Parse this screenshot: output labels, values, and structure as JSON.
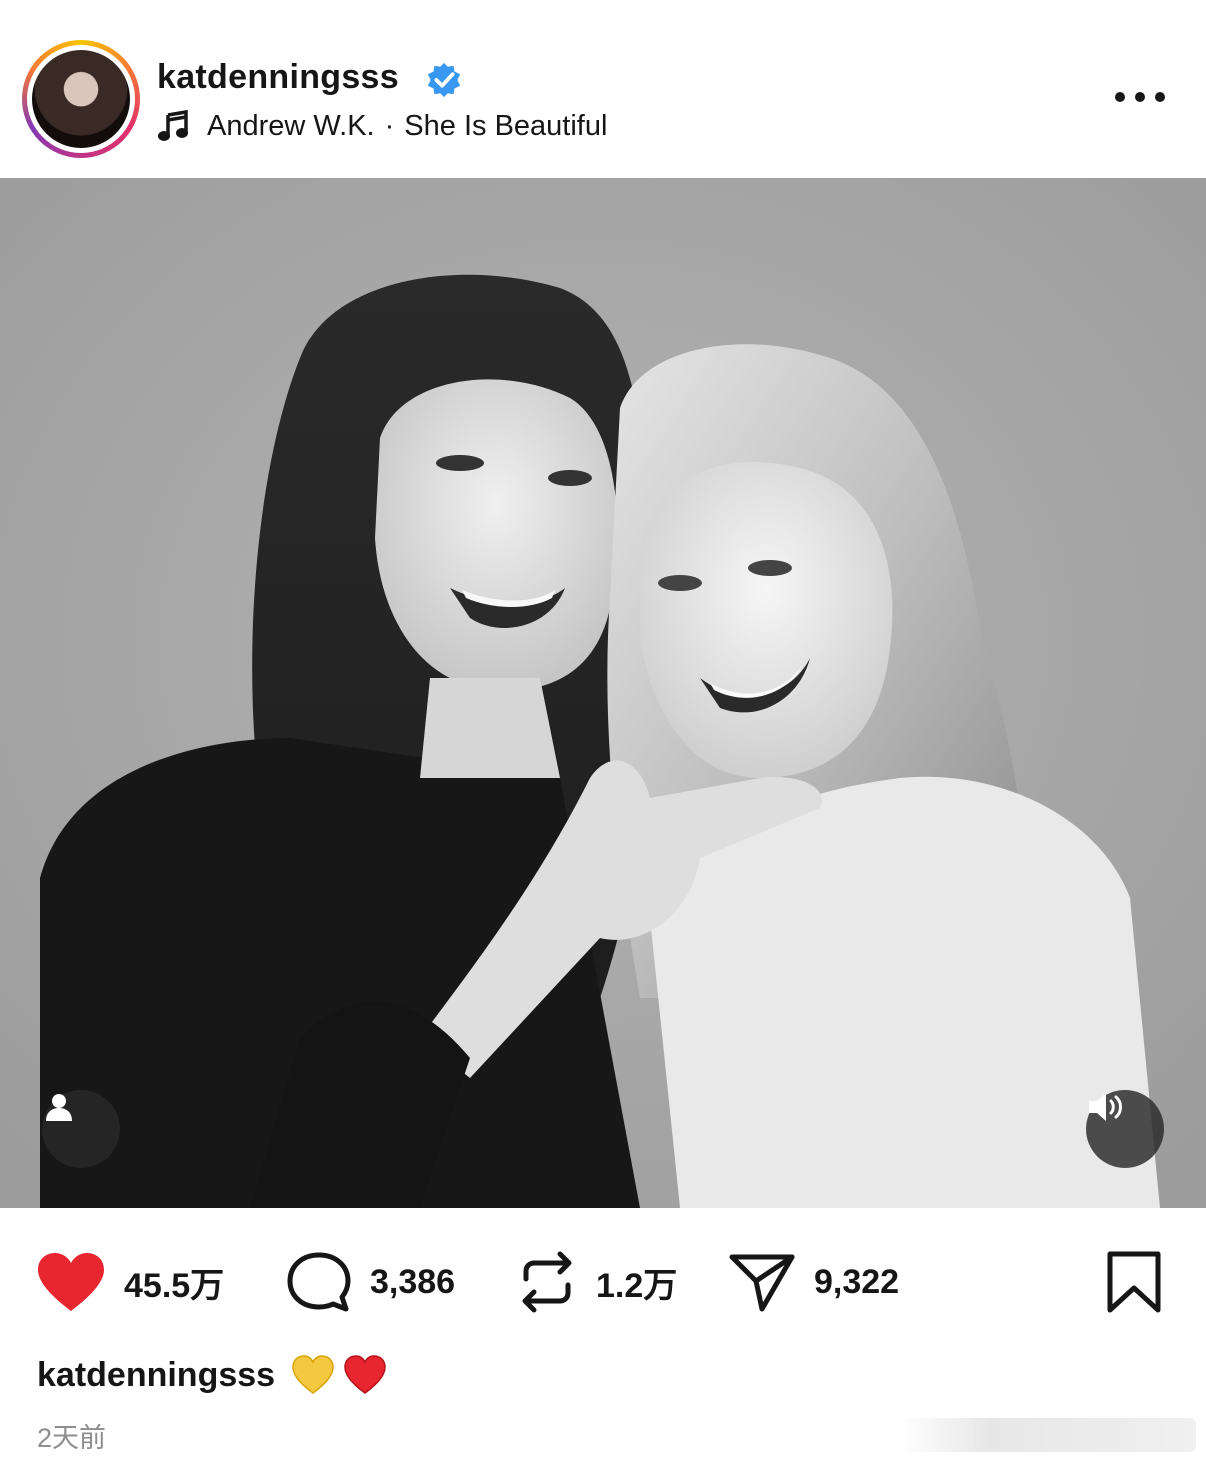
{
  "post": {
    "username": "katdenningsss",
    "verified_icon": "verified-badge-icon",
    "music": {
      "artist": "Andrew W.K.",
      "separator": "·",
      "title": "She Is Beautiful"
    },
    "more_icon": "more-options-icon"
  },
  "media": {
    "description_icons": [
      "tag-people-icon",
      "sound-icon"
    ]
  },
  "actions": {
    "likes": "45.5万",
    "comments": "3,386",
    "reposts": "1.2万",
    "shares": "9,322"
  },
  "caption": {
    "username": "katdenningsss",
    "emojis": [
      "yellow-heart",
      "red-heart"
    ]
  },
  "time": "2天前",
  "colors": {
    "like": "#e8262f",
    "verified": "#3897f0",
    "text": "#161616",
    "muted": "#8e8e8e"
  }
}
